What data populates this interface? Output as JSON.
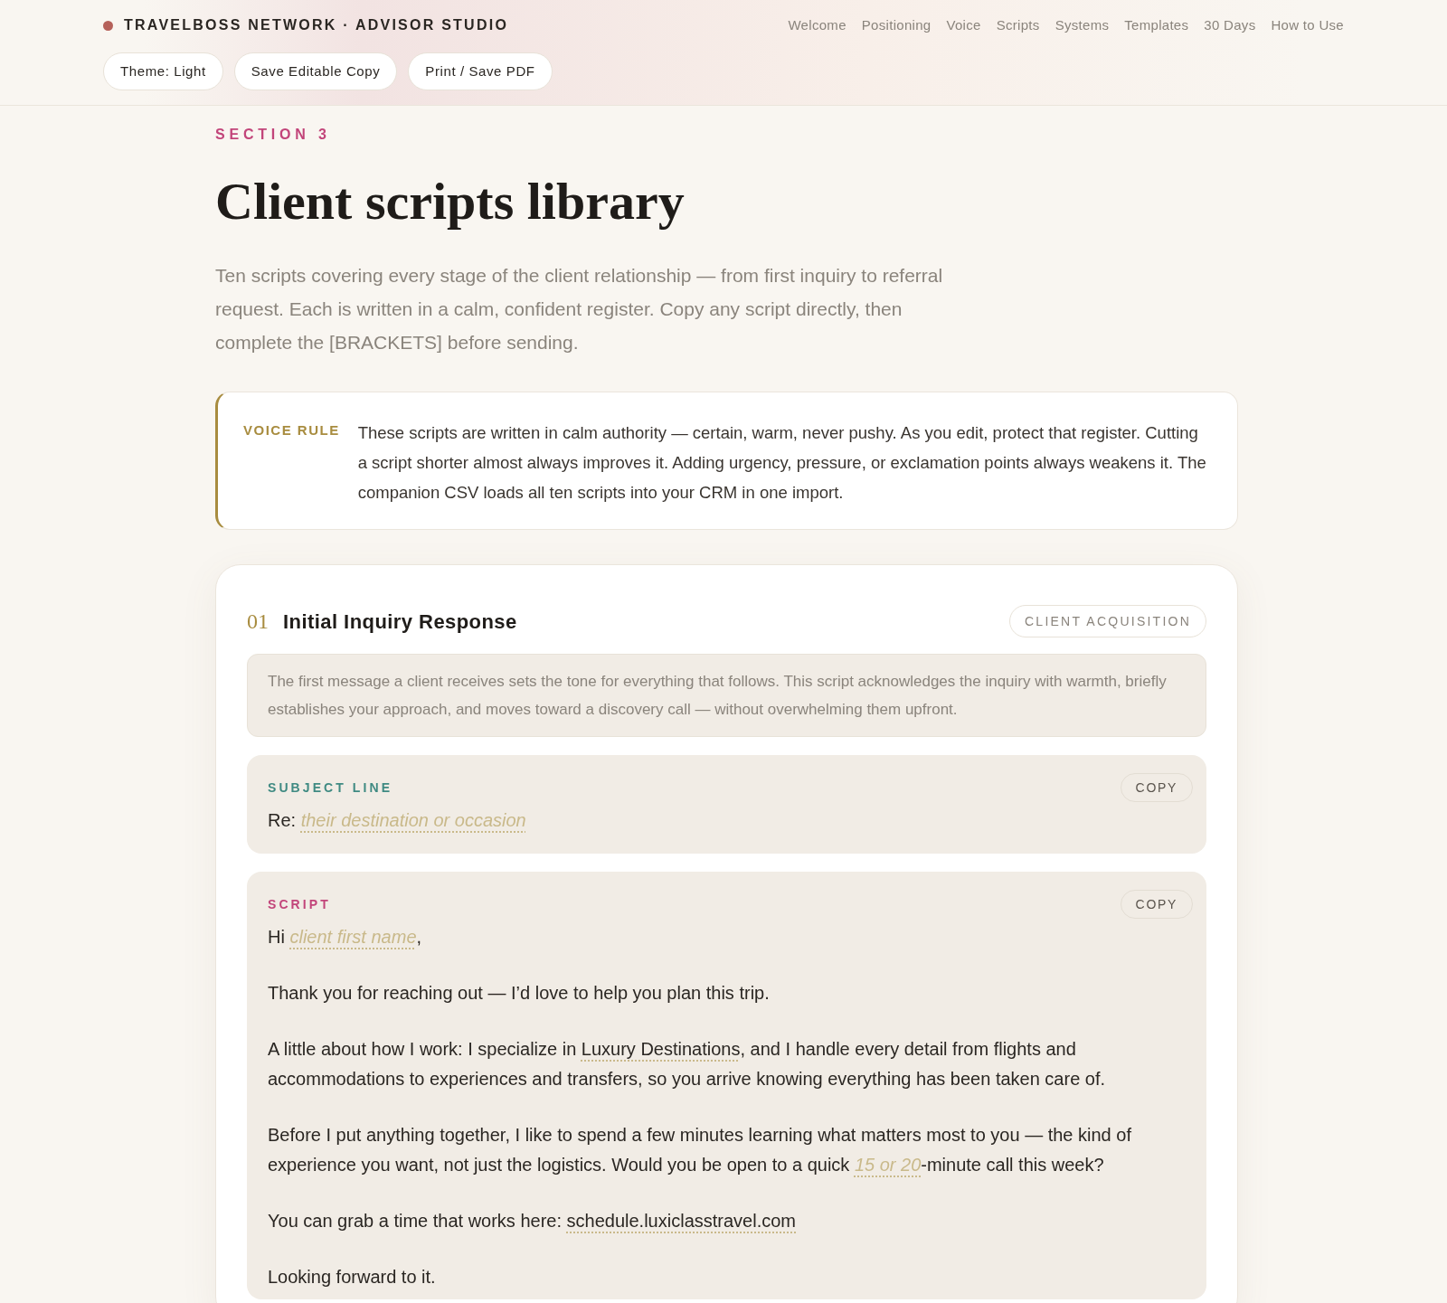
{
  "header": {
    "brand": "TRAVELBOSS NETWORK · ADVISOR STUDIO",
    "nav": [
      "Welcome",
      "Positioning",
      "Voice",
      "Scripts",
      "Systems",
      "Templates",
      "30 Days",
      "How to Use"
    ],
    "buttons": [
      "Theme: Light",
      "Save Editable Copy",
      "Print / Save PDF"
    ]
  },
  "section": {
    "eyebrow": "SECTION 3",
    "title": "Client scripts library",
    "intro": "Ten scripts covering every stage of the client relationship — from first inquiry to referral request. Each is written in a calm, confident register. Copy any script directly, then complete the [BRACKETS] before sending."
  },
  "callout": {
    "label": "VOICE RULE",
    "text": "These scripts are written in calm authority — certain, warm, never pushy. As you edit, protect that register. Cutting a script shorter almost always improves it. Adding urgency, pressure, or exclamation points always weakens it. The companion CSV loads all ten scripts into your CRM in one import."
  },
  "script_card": {
    "number": "01",
    "title": "Initial Inquiry Response",
    "tag": "CLIENT ACQUISITION",
    "description": "The first message a client receives sets the tone for everything that follows. This script acknowledges the inquiry with warmth, briefly establishes your approach, and moves toward a discovery call — without overwhelming them upfront.",
    "blocks": [
      {
        "kind": "subject",
        "label": "SUBJECT LINE",
        "copy": "COPY",
        "paragraphs": [
          [
            {
              "kind": "text",
              "text": "Re: "
            },
            {
              "kind": "placeholder",
              "text": "their destination or occasion"
            }
          ]
        ]
      },
      {
        "kind": "script",
        "label": "SCRIPT",
        "copy": "COPY",
        "paragraphs": [
          [
            {
              "kind": "text",
              "text": "Hi "
            },
            {
              "kind": "placeholder",
              "text": "client first name"
            },
            {
              "kind": "text",
              "text": ","
            }
          ],
          [
            {
              "kind": "text",
              "text": "Thank you for reaching out — I’d love to help you plan this trip."
            }
          ],
          [
            {
              "kind": "text",
              "text": "A little about how I work: I specialize in "
            },
            {
              "kind": "filled",
              "text": "Luxury Destinations"
            },
            {
              "kind": "text",
              "text": ", and I handle every detail from flights and accommodations to experiences and transfers, so you arrive knowing everything has been taken care of."
            }
          ],
          [
            {
              "kind": "text",
              "text": "Before I put anything together, I like to spend a few minutes learning what matters most to you — the kind of experience you want, not just the logistics. Would you be open to a quick "
            },
            {
              "kind": "placeholder",
              "text": "15 or 20"
            },
            {
              "kind": "text",
              "text": "-minute call this week?"
            }
          ],
          [
            {
              "kind": "text",
              "text": "You can grab a time that works here: "
            },
            {
              "kind": "filled",
              "text": "schedule.luxiclasstravel.com"
            }
          ],
          [
            {
              "kind": "text",
              "text": "Looking forward to it."
            }
          ]
        ]
      }
    ]
  }
}
